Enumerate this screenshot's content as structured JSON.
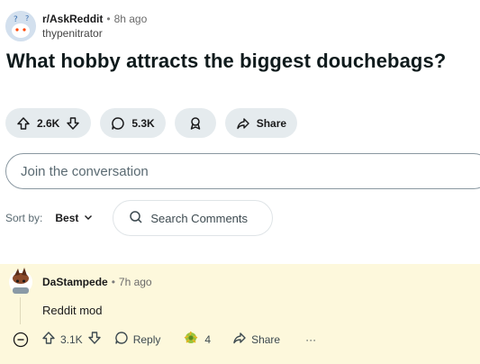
{
  "post": {
    "subreddit": "r/AskReddit",
    "time": "8h ago",
    "author": "thypenitrator",
    "title": "What hobby attracts the biggest douchebags?",
    "votes": "2.6K",
    "comments": "5.3K",
    "share_label": "Share"
  },
  "join": {
    "placeholder": "Join the conversation"
  },
  "sort": {
    "label": "Sort by:",
    "value": "Best"
  },
  "search": {
    "placeholder": "Search Comments"
  },
  "comment": {
    "author": "DaStampede",
    "time": "7h ago",
    "body": "Reddit mod",
    "votes": "3.1K",
    "reply_label": "Reply",
    "award_count": "4",
    "share_label": "Share",
    "more_label": "···"
  },
  "colors": {
    "pill_bg": "#e5ebee",
    "comment_bg": "#fdf8dc"
  }
}
